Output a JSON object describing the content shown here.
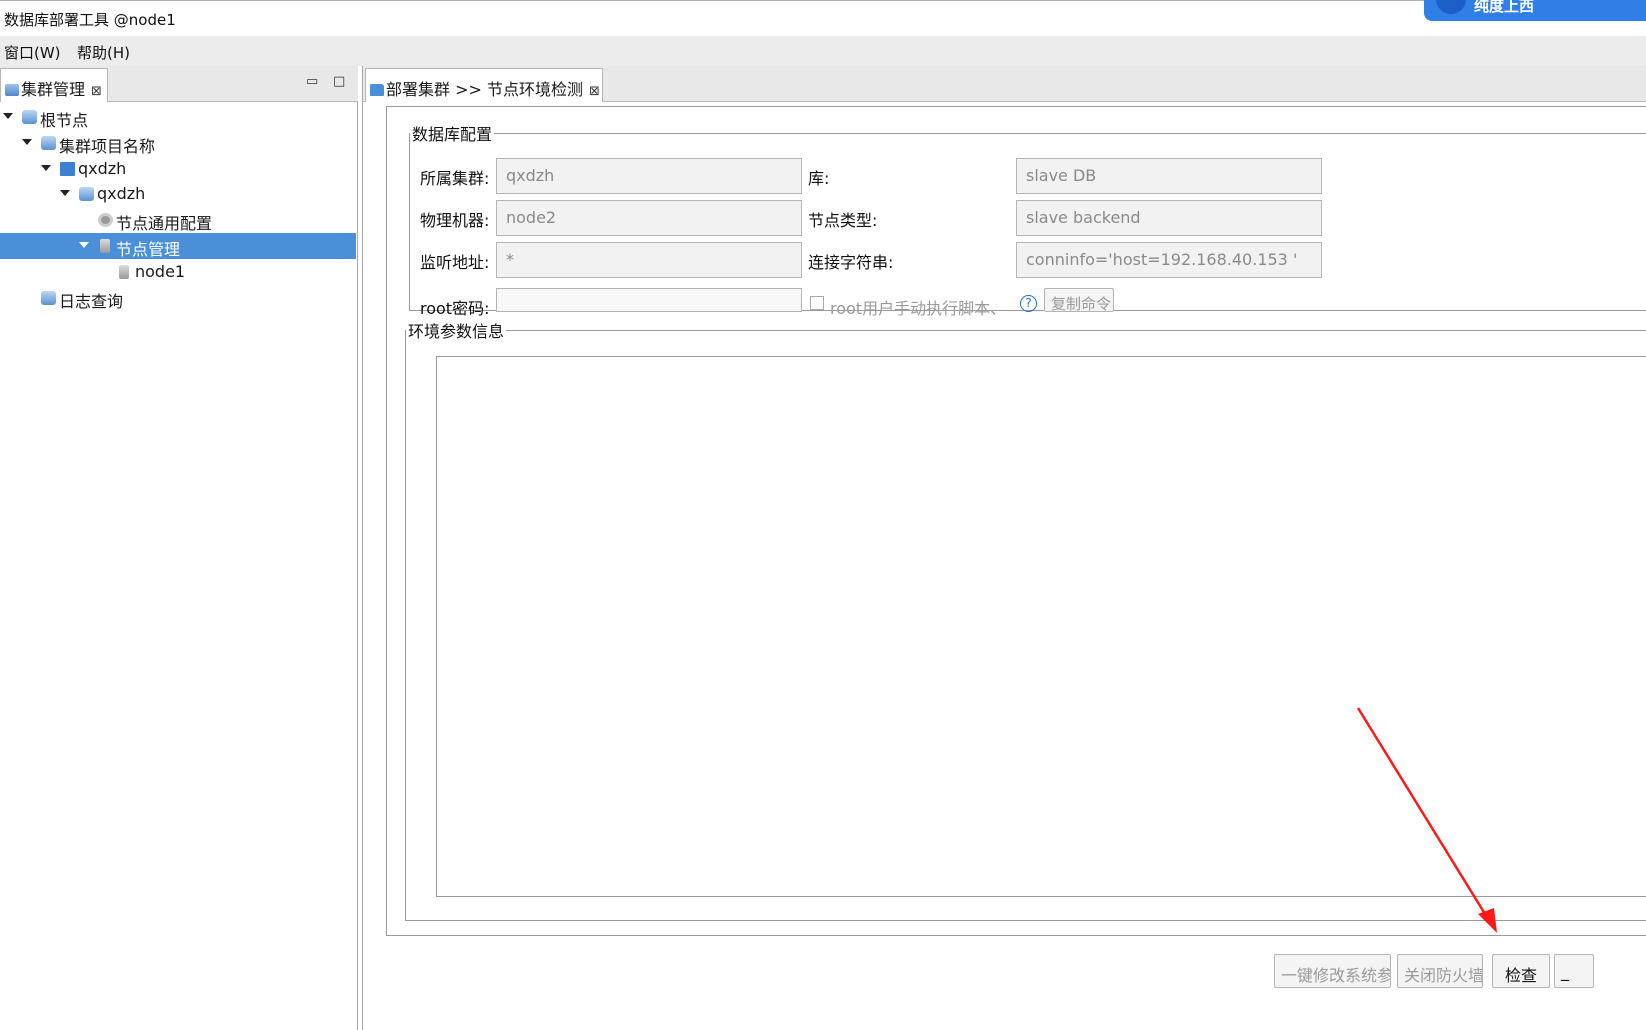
{
  "window": {
    "title": "数据库部署工具 @node1",
    "badge_text": "纯度上西"
  },
  "menubar": {
    "window_menu": "窗口(W)",
    "help_menu": "帮助(H)"
  },
  "left_view": {
    "tab_label": "集群管理",
    "close_glyph": "⊠",
    "minimize_glyph": "▭",
    "maximize_glyph": "□"
  },
  "tree": {
    "items": [
      {
        "label": "根节点"
      },
      {
        "label": "集群项目名称"
      },
      {
        "label": "qxdzh"
      },
      {
        "label": "qxdzh"
      },
      {
        "label": "节点通用配置"
      },
      {
        "label": "节点管理"
      },
      {
        "label": "node1"
      },
      {
        "label": "日志查询"
      }
    ]
  },
  "editor": {
    "tab_label": "部署集群 >> 节点环境检测",
    "close_glyph": "⊠"
  },
  "db_config": {
    "legend": "数据库配置",
    "cluster_label": "所属集群:",
    "cluster_value": "qxdzh",
    "db_label": "库:",
    "db_value": "slave DB",
    "machine_label": "物理机器:",
    "machine_value": "node2",
    "node_type_label": "节点类型:",
    "node_type_value": "slave backend",
    "listen_label": "监听地址:",
    "listen_value": "*",
    "conn_label": "连接字符串:",
    "conn_value": "conninfo='host=192.168.40.153 '",
    "root_pwd_label": "root密码:",
    "root_pwd_value": "",
    "manual_script_label": "root用户手动执行脚本、",
    "help_glyph": "?",
    "copy_cmd_button": "复制命令"
  },
  "env_info": {
    "legend": "环境参数信息"
  },
  "buttons": {
    "modify_system": "一键修改系统参数",
    "close_firewall": "关闭防火墙",
    "check": "检查",
    "more": "_"
  },
  "colors": {
    "selection": "#4a90d9",
    "annotation_arrow": "#ff1a1a"
  }
}
